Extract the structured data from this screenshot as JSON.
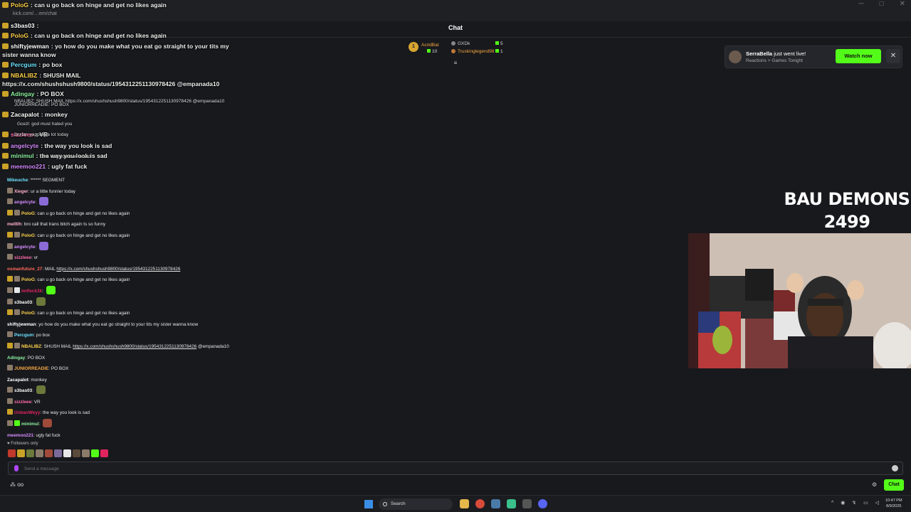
{
  "window": {
    "url_fragment": "kick.com/...:em/chat"
  },
  "overlay_chat": [
    {
      "user": "PoloG",
      "text": "can u go back on hinge and get no likes again",
      "color": "#ffd24a"
    },
    {
      "user": "s3bas03",
      "text": "",
      "color": "#ffffff"
    },
    {
      "user": "PoloG",
      "text": "can u go back on hinge and get no likes again",
      "color": "#ffd24a"
    },
    {
      "user": "shiftyjewman",
      "text": "yo how do you make what you eat go straight to your tits my",
      "color": "#ffffff"
    },
    {
      "user": "",
      "text": "sister wanna know",
      "color": "#ffffff"
    },
    {
      "user": "Percgum",
      "text": "po box",
      "color": "#6ce4ff"
    },
    {
      "user": "NBALIBZ",
      "text": "SHUSH MAIL",
      "color": "#ffd24a"
    },
    {
      "user": "",
      "text": "https://x.com/shushshush9800/status/1954312251130978426 @empanada10",
      "color": "#ffffff"
    },
    {
      "user": "Adingay",
      "text": "PO BOX",
      "color": "#8cf0a0"
    },
    {
      "user": "Zacapalot",
      "text": "monkey",
      "color": "#ffffff"
    },
    {
      "user": "sizzleee",
      "text": "VR",
      "color": "#ff6aa8"
    },
    {
      "user": "angelcyte",
      "text": "the way you look is sad",
      "color": "#d68bff"
    },
    {
      "user": "minimul",
      "text": "the way you look is sad",
      "color": "#8cf0a0"
    },
    {
      "user": "meemoo221",
      "text": "ugly fat fuck",
      "color": "#d68bff"
    }
  ],
  "overlay_small": [
    "NBALIBZ: SHUSH MAIL https://x.com/shushshush9800/status/1954312251130978426 @empanada10",
    "JUNIORREADIE: PO BOX",
    "Gcezl: god must hated you",
    "dextar: yapping a lot today",
    "the way you look is sad"
  ],
  "header": {
    "title": "Chat"
  },
  "leaderboard": {
    "first": {
      "rank": "1",
      "name": "AcridBat",
      "value": "10"
    },
    "second": {
      "name": "GXDk",
      "value": "5"
    },
    "third": {
      "name": "Truskinglegend98",
      "value": "1"
    }
  },
  "notification": {
    "user": "SerraBella",
    "suffix": "just went live!",
    "sub": "Reactions + Games Tonight",
    "button": "Watch now",
    "close": "✕"
  },
  "messages": [
    {
      "user": "Mikeuche",
      "color": "#6ce4ff",
      "text": "****** SEGMENT",
      "badges": []
    },
    {
      "user": "Xieger",
      "color": "#ffb0c8",
      "text": "ur a little funnier today",
      "badges": [
        "#8a7a6a"
      ]
    },
    {
      "user": "angelcyte",
      "color": "#d68bff",
      "text": "",
      "badges": [
        "#8a7a6a"
      ],
      "emote": "#8a6bd6"
    },
    {
      "user": "PoloG",
      "color": "#ffd24a",
      "text": "can u go back on hinge and get no likes again",
      "badges": [
        "#c9a227",
        "#8a7a6a"
      ]
    },
    {
      "user": "mell0h",
      "color": "#ffb0c8",
      "text": "bro call that trans bitch again ts so funny",
      "badges": []
    },
    {
      "user": "PoloG",
      "color": "#ffd24a",
      "text": "can u go back on hinge and get no likes again",
      "badges": [
        "#c9a227",
        "#8a7a6a"
      ]
    },
    {
      "user": "angelcyte",
      "color": "#d68bff",
      "text": "",
      "badges": [
        "#8a7a6a"
      ],
      "emote": "#8a6bd6"
    },
    {
      "user": "sizzleee",
      "color": "#ff6aa8",
      "text": "vr",
      "badges": [
        "#8a7a6a"
      ]
    },
    {
      "user": "osmanfuture_27",
      "color": "#ff6a5a",
      "text": "MAIL ",
      "link": "https://x.com/shushshush9800/status/1954312251130978426",
      "badges": []
    },
    {
      "user": "PoloG",
      "color": "#ffd24a",
      "text": "can u go back on hinge and get no likes again",
      "badges": [
        "#c9a227",
        "#8a7a6a"
      ]
    },
    {
      "user": "imfleck3k",
      "color": "#e0245e",
      "text": "",
      "badges": [
        "#8a7a6a",
        "#e6e6e6"
      ],
      "emote": "#53fc18"
    },
    {
      "user": "s3bas03",
      "color": "#ffffff",
      "text": "",
      "badges": [
        "#8a7a6a"
      ],
      "emote": "#6b7a3a"
    },
    {
      "user": "PoloG",
      "color": "#ffd24a",
      "text": "can u go back on hinge and get no likes again",
      "badges": [
        "#c9a227",
        "#8a7a6a"
      ]
    },
    {
      "user": "shiftyjewman",
      "color": "#ffffff",
      "text": "yo how do you make what you eat go straight to your tits my sister wanna know",
      "badges": []
    },
    {
      "user": "Percgum",
      "color": "#6ce4ff",
      "text": "po box",
      "badges": [
        "#8a7a6a"
      ]
    },
    {
      "user": "NBALIBZ",
      "color": "#ffd24a",
      "text": "SHUSH MAIL ",
      "link": "https://x.com/shushshush9800/status/1954312251130978426",
      "after": " @empanada10",
      "badges": [
        "#c9a227",
        "#8a7a6a"
      ]
    },
    {
      "user": "Adingay",
      "color": "#8cf0a0",
      "text": "PO BOX",
      "badges": []
    },
    {
      "user": "JUNIORREADIE",
      "color": "#f4a742",
      "text": "PO BOX",
      "badges": [
        "#8a7a6a"
      ]
    },
    {
      "user": "Zacapalot",
      "color": "#ffffff",
      "text": "monkey",
      "badges": []
    },
    {
      "user": "s3bas03",
      "color": "#ffffff",
      "text": "",
      "badges": [
        "#8a7a6a"
      ],
      "emote": "#6b7a3a"
    },
    {
      "user": "sizzleee",
      "color": "#ff6aa8",
      "text": "VR",
      "badges": [
        "#8a7a6a"
      ]
    },
    {
      "user": "UnbanWeyy",
      "color": "#e0245e",
      "text": "the way you look is sad",
      "badges": [
        "#c9a227"
      ]
    },
    {
      "user": "minimul",
      "color": "#8cf0a0",
      "text": "",
      "badges": [
        "#8a7a6a",
        "#53fc18"
      ],
      "emote": "#a04a3a"
    },
    {
      "user": "meemoo221",
      "color": "#d68bff",
      "text": "ugly fat fuck",
      "badges": []
    }
  ],
  "followers_only": "Followers only",
  "emote_bar": [
    "#c0392b",
    "#c9a227",
    "#6b7a3a",
    "#8a7a6a",
    "#a04a3a",
    "#7a6a9a",
    "#e6e6e6",
    "#5a4a3a",
    "#8a7a6a",
    "#53fc18",
    "#e0245e"
  ],
  "input": {
    "placeholder": "Send a message"
  },
  "footer": {
    "send_button": "Chat",
    "left_icons": "oo"
  },
  "stream": {
    "title_line1": "BAU DEMONS",
    "title_line2": "2499"
  },
  "taskbar": {
    "search": "Search",
    "time": "10:47 PM",
    "date": "8/9/2025"
  },
  "colors": {
    "accent": "#53fc18",
    "background": "#18191d"
  }
}
